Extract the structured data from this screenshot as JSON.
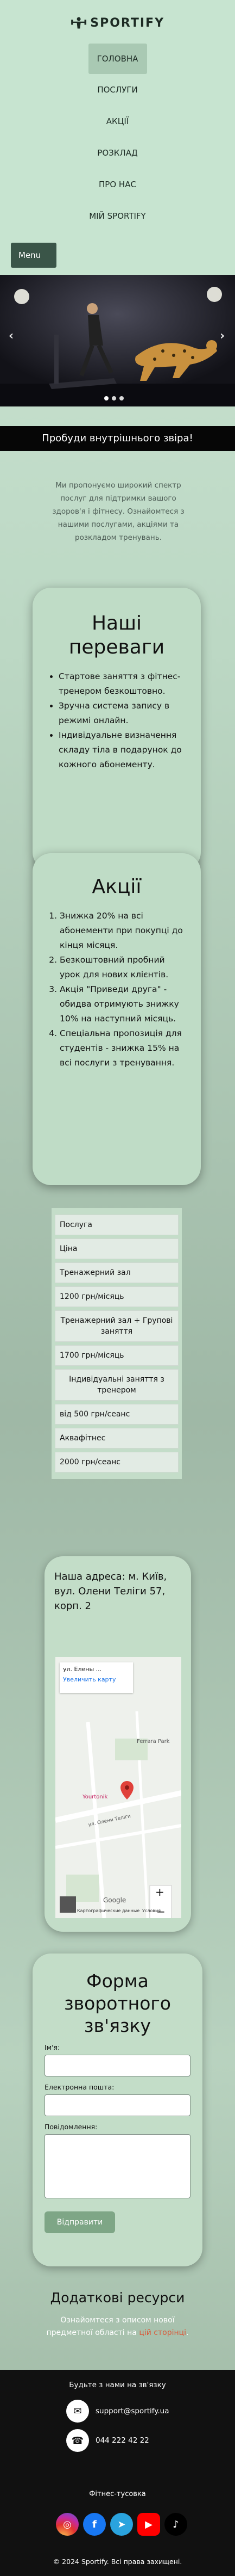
{
  "brand": {
    "name": "SPORTIFY"
  },
  "nav": {
    "items": [
      "ГОЛОВНА",
      "ПОСЛУГИ",
      "АКЦІЇ",
      "РОЗКЛАД",
      "ПРО НАС",
      "МІЙ SPORTIFY"
    ],
    "menu_button": "Menu"
  },
  "carousel": {
    "prev": "‹",
    "next": "›",
    "slide_count": 3,
    "active_slide": 1
  },
  "banner": {
    "text": "Пробуди внутрішнього звіра!"
  },
  "intro": {
    "text": "Ми пропонуємо широкий спектр послуг для підтримки вашого здоров'я і фітнесу. Ознайомтеся з нашими послугами, акціями та розкладом тренувань."
  },
  "advantages": {
    "title": "Наші переваги",
    "items": [
      "Стартове заняття з фітнес-тренером безкоштовно.",
      "Зручна система запису в режимі онлайн.",
      "Індивідуальне визначення складу тіла в подарунок до кожного абонементу."
    ]
  },
  "promos": {
    "title": "Акції",
    "items": [
      "Знижка 20% на всі абонементи при покупці до кінця місяця.",
      "Безкоштовний пробний урок для нових клієнтів.",
      "Акція \"Приведи друга\" - обидва отримують знижку 10% на наступний місяць.",
      "Спеціальна пропозиція для студентів - знижка 15% на всі послуги з тренування."
    ]
  },
  "prices": {
    "header_service": "Послуга",
    "header_price": "Ціна",
    "rows": [
      {
        "service": "Тренажерний зал",
        "price": "1200 грн/місяць"
      },
      {
        "service": "Тренажерний зал + Групові заняття",
        "price": "1700 грн/місяць"
      },
      {
        "service": "Індивідуальні заняття з тренером",
        "price": "від 500 грн/сеанс"
      },
      {
        "service": "Аквафітнес",
        "price": "2000 грн/сеанс"
      }
    ]
  },
  "address": {
    "text": "Наша адреса: м. Київ, вул. Олени Теліги 57, корп. 2",
    "map": {
      "card_title": "ул. Елены ...",
      "card_link": "Увеличить карту",
      "label_1": "Ferrara Park",
      "label_2": "Yourtonik",
      "label_3": "ул. Олени Теліги",
      "zoom_in": "+",
      "zoom_out": "−",
      "footer": "Картографические данные",
      "footer_terms": "Условия",
      "google": "Google"
    }
  },
  "form": {
    "title": "Форма зворотного зв'язку",
    "name_label": "Ім'я:",
    "email_label": "Електронна пошта:",
    "message_label": "Повідомлення:",
    "submit": "Відправити"
  },
  "resources": {
    "title": "Додаткові ресурси",
    "text_before": "Ознайомтеся з описом нової предметної області на",
    "link_text": "цій сторінці",
    "text_after": "."
  },
  "footer": {
    "contact_title": "Будьте з нами на зв'язку",
    "email": "support@sportify.ua",
    "phone": "044 222 42 22",
    "social_title": "Фітнес-тусовка",
    "copyright": "© 2024 Sportify. Всі права захищені."
  },
  "colors": {
    "accent": "#7ea686",
    "header_bg": "#c7e4d0",
    "card_bg": "#bfdcc6",
    "link": "#d95a3a"
  }
}
